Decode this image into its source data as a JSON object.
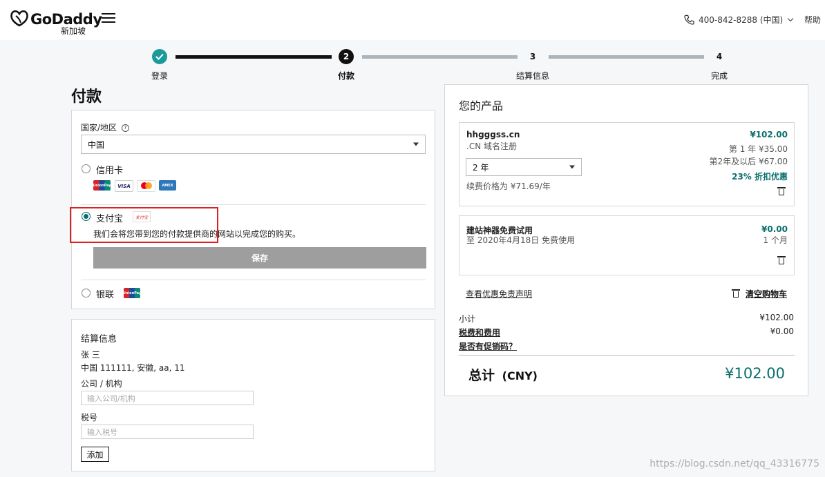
{
  "header": {
    "brand": "GoDaddy",
    "region": "新加坡",
    "phone": "400-842-8288 (中国)",
    "help": "帮助"
  },
  "steps": [
    {
      "num": "",
      "label": "登录",
      "state": "done"
    },
    {
      "num": "2",
      "label": "付款",
      "state": "current"
    },
    {
      "num": "3",
      "label": "结算信息",
      "state": "todo"
    },
    {
      "num": "4",
      "label": "完成",
      "state": "todo"
    }
  ],
  "payment": {
    "title": "付款",
    "country_label": "国家/地区",
    "country_value": "中国",
    "credit_card": "信用卡",
    "card_brands": [
      "UnionPay",
      "VISA",
      "Mastercard",
      "AMEX"
    ],
    "alipay": "支付宝",
    "alipay_logo": "支付宝",
    "alipay_desc": "我们会将您带到您的付款提供商的网站以完成您的购买。",
    "save": "保存",
    "unionpay": "银联"
  },
  "billing": {
    "title": "结算信息",
    "name": "张 三",
    "address": "中国 111111, 安徽, aa, 11",
    "company_label": "公司 / 机构",
    "company_placeholder": "输入公司/机构",
    "tax_label": "税号",
    "tax_placeholder": "输入税号",
    "add": "添加"
  },
  "cart": {
    "title": "您的产品",
    "item1": {
      "name": "hhgggss.cn",
      "type": ".CN 域名注册",
      "term": "2 年",
      "renew": "续费价格为 ¥71.69/年",
      "price": "¥102.00",
      "year1": "第 1 年 ¥35.00",
      "year2": "第2年及以后 ¥67.00",
      "discount": "23% 折扣优惠"
    },
    "item2": {
      "name": "建站神器免费试用",
      "desc": "至 2020年4月18日 免费使用",
      "price": "¥0.00",
      "period": "1 个月"
    },
    "disclaimer": "查看优惠免责声明",
    "clear": "清空购物车",
    "subtotal_label": "小计",
    "subtotal": "¥102.00",
    "tax_label": "税费和费用",
    "tax": "¥0.00",
    "promo": "是否有促销码？",
    "total_label": "总计",
    "currency": "(CNY)",
    "total": "¥102.00"
  },
  "watermark": "https://blog.csdn.net/qq_43316775",
  "colors": {
    "accent": "#0b6e6e",
    "highlight": "#e02020"
  }
}
